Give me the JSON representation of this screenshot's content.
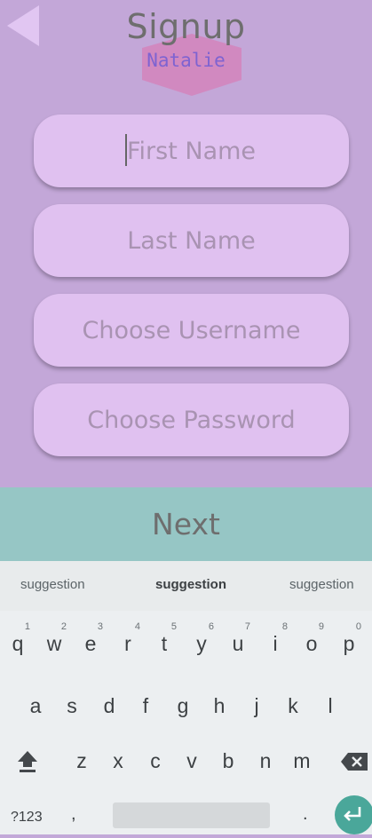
{
  "header": {
    "title": "Signup",
    "badge_name": "Natalie",
    "back_icon": "back-triangle-icon"
  },
  "form": {
    "first_name_placeholder": "First Name",
    "last_name_placeholder": "Last Name",
    "username_placeholder": "Choose Username",
    "password_placeholder": "Choose Password"
  },
  "next_label": "Next",
  "suggestions": [
    "suggestion",
    "suggestion",
    "suggestion"
  ],
  "keyboard": {
    "row1": [
      {
        "key": "q",
        "num": "1"
      },
      {
        "key": "w",
        "num": "2"
      },
      {
        "key": "e",
        "num": "3"
      },
      {
        "key": "r",
        "num": "4"
      },
      {
        "key": "t",
        "num": "5"
      },
      {
        "key": "y",
        "num": "6"
      },
      {
        "key": "u",
        "num": "7"
      },
      {
        "key": "i",
        "num": "8"
      },
      {
        "key": "o",
        "num": "9"
      },
      {
        "key": "p",
        "num": "0"
      }
    ],
    "row2": [
      "a",
      "s",
      "d",
      "f",
      "g",
      "h",
      "j",
      "k",
      "l"
    ],
    "row3": [
      "z",
      "x",
      "c",
      "v",
      "b",
      "n",
      "m"
    ],
    "symbols_label": "?123",
    "comma": ",",
    "period": "."
  },
  "colors": {
    "app_bg": "#c3a7d8",
    "field_bg": "#e0c1f0",
    "next_bg": "#96c6c5",
    "badge_fill": "#d67fb8",
    "enter_bg": "#4aa79a"
  }
}
